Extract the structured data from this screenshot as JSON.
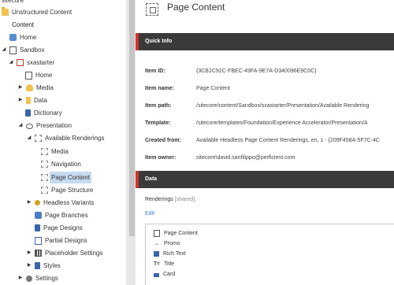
{
  "tree": {
    "items": [
      {
        "label": "sitecore",
        "level": 0
      },
      {
        "label": "Unstructured Content",
        "level": 0
      },
      {
        "label": "Content",
        "level": 0
      },
      {
        "label": "Home",
        "level": 1
      },
      {
        "label": "Sandbox",
        "level": 1
      },
      {
        "label": "sxastarter",
        "level": 2
      },
      {
        "label": "Home",
        "level": 3
      },
      {
        "label": "Media",
        "level": 3
      },
      {
        "label": "Data",
        "level": 3
      },
      {
        "label": "Dictionary",
        "level": 3
      },
      {
        "label": "Presentation",
        "level": 3
      },
      {
        "label": "Available Renderings",
        "level": 4
      },
      {
        "label": "Media",
        "level": 5
      },
      {
        "label": "Navigation",
        "level": 5
      },
      {
        "label": "Page Content",
        "level": 5,
        "selected": true
      },
      {
        "label": "Page Structure",
        "level": 5
      },
      {
        "label": "Headless Variants",
        "level": 4
      },
      {
        "label": "Page Branches",
        "level": 4
      },
      {
        "label": "Page Designs",
        "level": 4
      },
      {
        "label": "Partial Designs",
        "level": 4
      },
      {
        "label": "Placeholder Settings",
        "level": 4
      },
      {
        "label": "Styles",
        "level": 4
      },
      {
        "label": "Settings",
        "level": 3
      }
    ]
  },
  "item": {
    "title": "Page Content"
  },
  "sections": {
    "quick_info": "Quick Info",
    "data": "Data"
  },
  "fields": [
    {
      "label": "Item ID:",
      "value": "{3CB1C92C-FBEC-49FA-9E7A-D340096E9C0C}"
    },
    {
      "label": "Item name:",
      "value": "Page Content"
    },
    {
      "label": "Item path:",
      "value": "/sitecore/content/Sandbox/sxastarter/Presentation/Available Rendering"
    },
    {
      "label": "Template:",
      "value": "/sitecore/templates/Foundation/Experience Accelerator/Presentation/A"
    },
    {
      "label": "Created from:",
      "value": "Available Headless Page Content Renderings, en, 1 - {209F458A-5F7C-4C"
    },
    {
      "label": "Item owner:",
      "value": "sitecore\\david.sanfilippo@perficient.com"
    }
  ],
  "renderings": {
    "label": "Renderings",
    "shared": "[shared]:",
    "edit": "Edit",
    "items": [
      {
        "label": "Page Content",
        "icon": "page-icon"
      },
      {
        "label": "Promo",
        "icon": "promo-icon"
      },
      {
        "label": "Rich Text",
        "icon": "rich-text-icon"
      },
      {
        "label": "Title",
        "icon": "title-icon"
      },
      {
        "label": "Card",
        "icon": "card-icon"
      }
    ]
  },
  "colors": {
    "section_bar": "#3a3a3a",
    "section_accent": "#d0352b",
    "selected_bg": "#c6dbf0",
    "link": "#3a7bd5"
  }
}
